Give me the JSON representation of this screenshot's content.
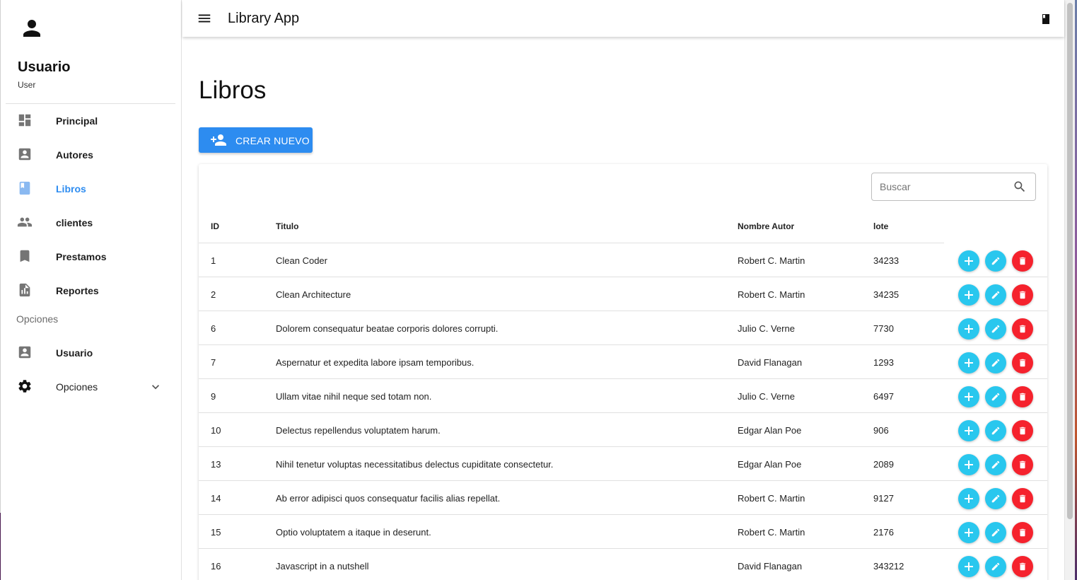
{
  "sidebar": {
    "profile": {
      "name": "Usuario",
      "role": "User"
    },
    "items": [
      {
        "label": "Principal",
        "icon": "dashboard-icon"
      },
      {
        "label": "Autores",
        "icon": "contact-card-icon"
      },
      {
        "label": "Libros",
        "icon": "book-icon",
        "active": true
      },
      {
        "label": "clientes",
        "icon": "people-icon"
      },
      {
        "label": "Prestamos",
        "icon": "bookmark-icon"
      },
      {
        "label": "Reportes",
        "icon": "report-icon"
      }
    ],
    "section_label": "Opciones",
    "options_items": [
      {
        "label": "Usuario",
        "icon": "contact-card-icon"
      },
      {
        "label": "Opciones",
        "icon": "gear-icon"
      }
    ]
  },
  "topbar": {
    "title": "Library App"
  },
  "main": {
    "title": "Libros",
    "create_label": "CREAR NUEVO",
    "search": {
      "placeholder": "Buscar",
      "value": ""
    },
    "columns": [
      "ID",
      "Titulo",
      "Nombre Autor",
      "lote"
    ],
    "rows": [
      {
        "id": "1",
        "titulo": "Clean Coder",
        "autor": "Robert C. Martin",
        "lote": "34233"
      },
      {
        "id": "2",
        "titulo": "Clean Architecture",
        "autor": "Robert C. Martin",
        "lote": "34235"
      },
      {
        "id": "6",
        "titulo": "Dolorem consequatur beatae corporis dolores corrupti.",
        "autor": "Julio C. Verne",
        "lote": "7730"
      },
      {
        "id": "7",
        "titulo": "Aspernatur et expedita labore ipsam temporibus.",
        "autor": "David Flanagan",
        "lote": "1293"
      },
      {
        "id": "9",
        "titulo": "Ullam vitae nihil neque sed totam non.",
        "autor": "Julio C. Verne",
        "lote": "6497"
      },
      {
        "id": "10",
        "titulo": "Delectus repellendus voluptatem harum.",
        "autor": "Edgar Alan Poe",
        "lote": "906"
      },
      {
        "id": "13",
        "titulo": "Nihil tenetur voluptas necessitatibus delectus cupiditate consectetur.",
        "autor": "Edgar Alan Poe",
        "lote": "2089"
      },
      {
        "id": "14",
        "titulo": "Ab error adipisci quos consequatur facilis alias repellat.",
        "autor": "Robert C. Martin",
        "lote": "9127"
      },
      {
        "id": "15",
        "titulo": "Optio voluptatem a itaque in deserunt.",
        "autor": "Robert C. Martin",
        "lote": "2176"
      },
      {
        "id": "16",
        "titulo": "Javascript in a nutshell",
        "autor": "David Flanagan",
        "lote": "343212"
      }
    ]
  },
  "colors": {
    "accent": "#2d8cf0",
    "action": "#29c7ee",
    "danger": "#f5222d"
  }
}
